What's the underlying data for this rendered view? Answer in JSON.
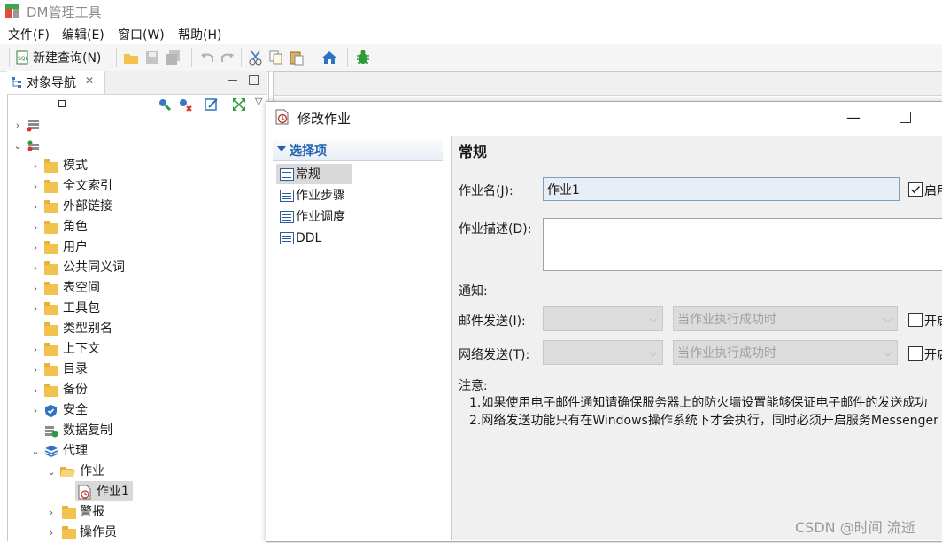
{
  "app": {
    "title": "DM管理工具"
  },
  "menu": [
    "文件(F)",
    "编辑(E)",
    "窗口(W)",
    "帮助(H)"
  ],
  "toolbar": {
    "new_query_label": "新建查询(N)"
  },
  "nav": {
    "tab_label": "对象导航",
    "tab_close": "✕",
    "tree": [
      {
        "label": "模式"
      },
      {
        "label": "全文索引"
      },
      {
        "label": "外部链接"
      },
      {
        "label": "角色"
      },
      {
        "label": "用户"
      },
      {
        "label": "公共同义词"
      },
      {
        "label": "表空间"
      },
      {
        "label": "工具包"
      },
      {
        "label": "类型别名"
      },
      {
        "label": "上下文"
      },
      {
        "label": "目录"
      },
      {
        "label": "备份"
      },
      {
        "label": "安全"
      },
      {
        "label": "数据复制"
      },
      {
        "label": "代理"
      },
      {
        "label": "作业"
      },
      {
        "label": "作业1"
      },
      {
        "label": "警报"
      },
      {
        "label": "操作员"
      }
    ]
  },
  "dialog": {
    "title": "修改作业",
    "minimize": "—",
    "options_header": "选择项",
    "options": [
      "常规",
      "作业步骤",
      "作业调度",
      "DDL"
    ],
    "section_title": "常规",
    "job_name_label": "作业名(J):",
    "job_name_value": "作业1",
    "enable_label": "启用",
    "job_desc_label": "作业描述(D):",
    "notify_label": "通知:",
    "mail_label": "邮件发送(I):",
    "mail_condition": "当作业执行成功时",
    "mail_check_label": "开启",
    "net_label": "网络发送(T):",
    "net_condition": "当作业执行成功时",
    "net_check_label": "开启",
    "note_title": "注意:",
    "note_1": "1.如果使用电子邮件通知请确保服务器上的防火墙设置能够保证电子邮件的发送成功",
    "note_2": "2.网络发送功能只有在Windows操作系统下才会执行，同时必须开启服务Messenger"
  },
  "watermark": "CSDN @时间 流逝"
}
